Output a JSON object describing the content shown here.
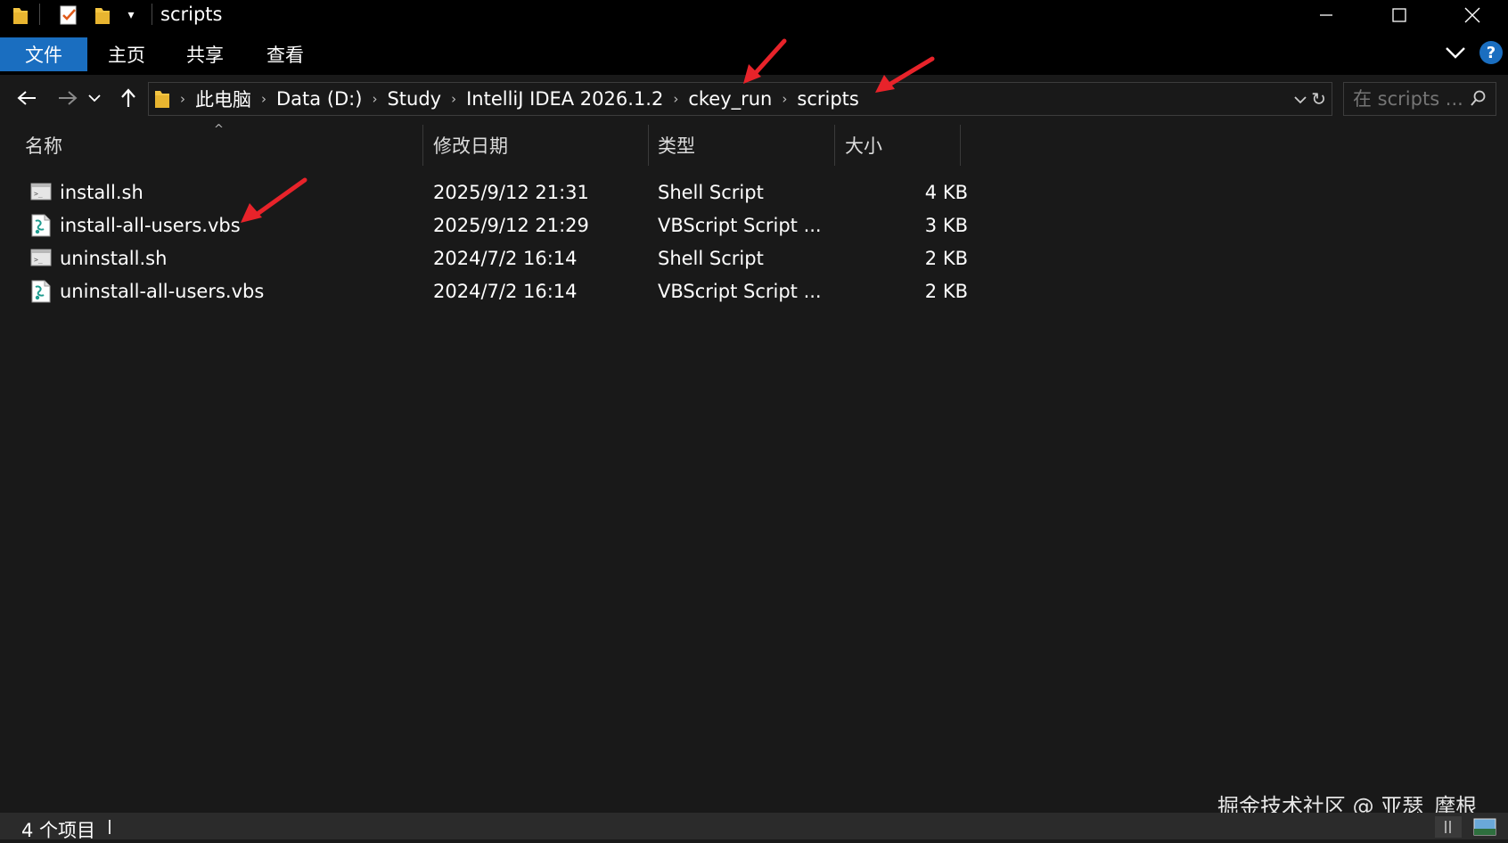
{
  "window": {
    "title": "scripts",
    "controls": {
      "minimize": "—",
      "maximize": "☐",
      "close": "✕"
    }
  },
  "ribbon": {
    "tabs": [
      {
        "label": "文件",
        "active": true
      },
      {
        "label": "主页"
      },
      {
        "label": "共享"
      },
      {
        "label": "查看"
      }
    ],
    "help": "?"
  },
  "address": {
    "crumbs": [
      "此电脑",
      "Data (D:)",
      "Study",
      "IntelliJ IDEA 2026.1.2",
      "ckey_run",
      "scripts"
    ]
  },
  "search": {
    "placeholder": "在 scripts ..."
  },
  "columns": {
    "name": "名称",
    "date": "修改日期",
    "type": "类型",
    "size": "大小"
  },
  "files": [
    {
      "name": "install.sh",
      "date": "2025/9/12 21:31",
      "type": "Shell Script",
      "size": "4 KB",
      "icon": "shell-file-icon"
    },
    {
      "name": "install-all-users.vbs",
      "date": "2025/9/12 21:29",
      "type": "VBScript Script ...",
      "size": "3 KB",
      "icon": "vbscript-file-icon"
    },
    {
      "name": "uninstall.sh",
      "date": "2024/7/2 16:14",
      "type": "Shell Script",
      "size": "2 KB",
      "icon": "shell-file-icon"
    },
    {
      "name": "uninstall-all-users.vbs",
      "date": "2024/7/2 16:14",
      "type": "VBScript Script ...",
      "size": "2 KB",
      "icon": "vbscript-file-icon"
    }
  ],
  "status": {
    "item_count": "4 个项目"
  },
  "watermark": "掘金技术社区 @ 亚瑟_摩根",
  "colors": {
    "background": "#191919",
    "accent": "#1a6ec0",
    "annotation": "#e8232a"
  }
}
